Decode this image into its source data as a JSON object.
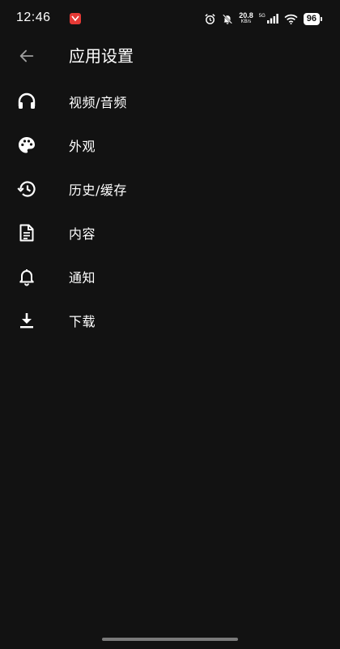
{
  "status_bar": {
    "time": "12:46",
    "net_speed_value": "20.8",
    "net_speed_unit": "KB/s",
    "network_type": "5G",
    "battery": "96",
    "icons": [
      "app-notification-icon",
      "alarm-icon",
      "notifications-off-icon",
      "signal-icon",
      "wifi-icon",
      "battery-icon"
    ]
  },
  "app_bar": {
    "title": "应用设置",
    "back_icon": "arrow-back-icon"
  },
  "menu": {
    "items": [
      {
        "label": "视频/音频",
        "icon": "headphones-icon"
      },
      {
        "label": "外观",
        "icon": "palette-icon"
      },
      {
        "label": "历史/缓存",
        "icon": "history-icon"
      },
      {
        "label": "内容",
        "icon": "document-icon"
      },
      {
        "label": "通知",
        "icon": "bell-icon"
      },
      {
        "label": "下载",
        "icon": "download-icon"
      }
    ]
  },
  "colors": {
    "background": "#121212",
    "text": "#ffffff",
    "accent_notification": "#e53935",
    "nav_handle": "#7a7a7a"
  }
}
